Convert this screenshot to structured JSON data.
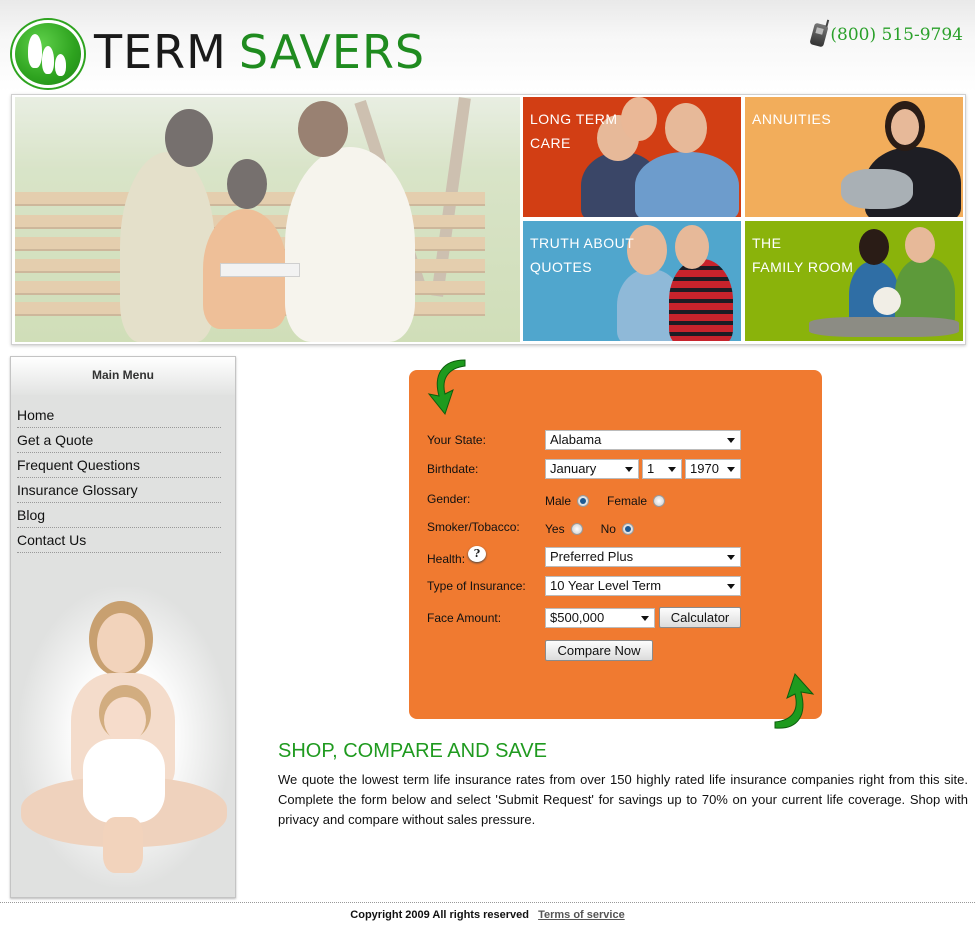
{
  "header": {
    "brand_part1": "TERM",
    "brand_part2": "SAVERS",
    "phone": "(800) 515-9794",
    "logo_icon": "family-figures-logo-icon",
    "phone_icon": "cell-phone-icon"
  },
  "banner": {
    "hero_image": "family-on-park-bench-photo",
    "tiles": [
      {
        "label": "LONG TERM\nCARE",
        "color": "#d23e14",
        "image": "grandparents-with-grandson-photo"
      },
      {
        "label": "ANNUITIES",
        "color": "#f2ad5b",
        "image": "mother-holding-baby-photo"
      },
      {
        "label": "TRUTH ABOUT\nQUOTES",
        "color": "#50a6cd",
        "image": "father-and-son-photo"
      },
      {
        "label": "THE\nFAMILY ROOM",
        "color": "#8ab30b",
        "image": "parents-with-baby-photo"
      }
    ]
  },
  "sidebar": {
    "title": "Main Menu",
    "items": [
      {
        "label": "Home"
      },
      {
        "label": "Get a Quote"
      },
      {
        "label": "Frequent Questions"
      },
      {
        "label": "Insurance Glossary"
      },
      {
        "label": "Blog"
      },
      {
        "label": "Contact Us"
      }
    ],
    "photo": "mother-and-daughter-photo"
  },
  "form": {
    "bg_color": "#f07a30",
    "state_label": "Your State:",
    "state_value": "Alabama",
    "birthdate_label": "Birthdate:",
    "birth_month": "January",
    "birth_day": "1",
    "birth_year": "1970",
    "gender_label": "Gender:",
    "gender_options": [
      "Male",
      "Female"
    ],
    "gender_selected": "Male",
    "smoker_label": "Smoker/Tobacco:",
    "smoker_options": [
      "Yes",
      "No"
    ],
    "smoker_selected": "No",
    "health_label": "Health:",
    "health_help": "?",
    "health_value": "Preferred Plus",
    "insurance_type_label": "Type of Insurance:",
    "insurance_type_value": "10 Year Level Term",
    "face_amount_label": "Face Amount:",
    "face_amount_value": "$500,000",
    "calculator_button": "Calculator",
    "compare_button": "Compare Now"
  },
  "content": {
    "title": "SHOP, COMPARE AND SAVE",
    "title_color": "#1f9a1f",
    "body": "We quote the lowest term life insurance rates from over 150 highly rated life insurance companies right from this site. Complete the form below and select 'Submit Request' for savings up to 70% on your current life coverage. Shop with privacy and compare without sales pressure."
  },
  "footer": {
    "copyright": "Copyright 2009 All rights reserved",
    "terms_link": "Terms of service"
  }
}
